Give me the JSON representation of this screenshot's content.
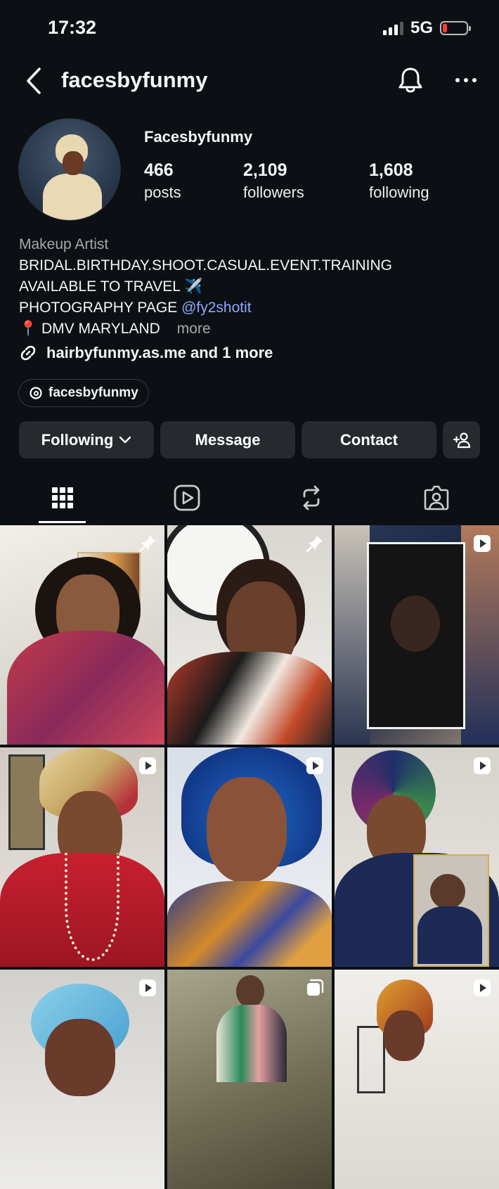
{
  "status_bar": {
    "time": "17:32",
    "network": "5G"
  },
  "header": {
    "username": "facesbyfunmy"
  },
  "profile": {
    "display_name": "Facesbyfunmy",
    "stats": [
      {
        "value": "466",
        "label": "posts"
      },
      {
        "value": "2,109",
        "label": "followers"
      },
      {
        "value": "1,608",
        "label": "following"
      }
    ]
  },
  "bio": {
    "category": "Makeup Artist",
    "line1": "BRIDAL.BIRTHDAY.SHOOT.CASUAL.EVENT.TRAINING",
    "line2": "AVAILABLE TO TRAVEL ✈️",
    "line3_prefix": "PHOTOGRAPHY PAGE ",
    "line3_mention": "@fy2shotit",
    "line4": "📍 DMV MARYLAND",
    "more": "more"
  },
  "link": {
    "text": "hairbyfunmy.as.me and 1 more"
  },
  "threads": {
    "handle": "facesbyfunmy"
  },
  "actions": {
    "following": "Following",
    "message": "Message",
    "contact": "Contact"
  },
  "colors": {
    "background": "#0c1014",
    "button": "#26292e",
    "mention": "#8fa8ff"
  },
  "grid_badges": [
    "pin",
    "pin",
    "reel",
    "reel",
    "reel",
    "reel",
    "reel",
    "carousel",
    "reel"
  ]
}
